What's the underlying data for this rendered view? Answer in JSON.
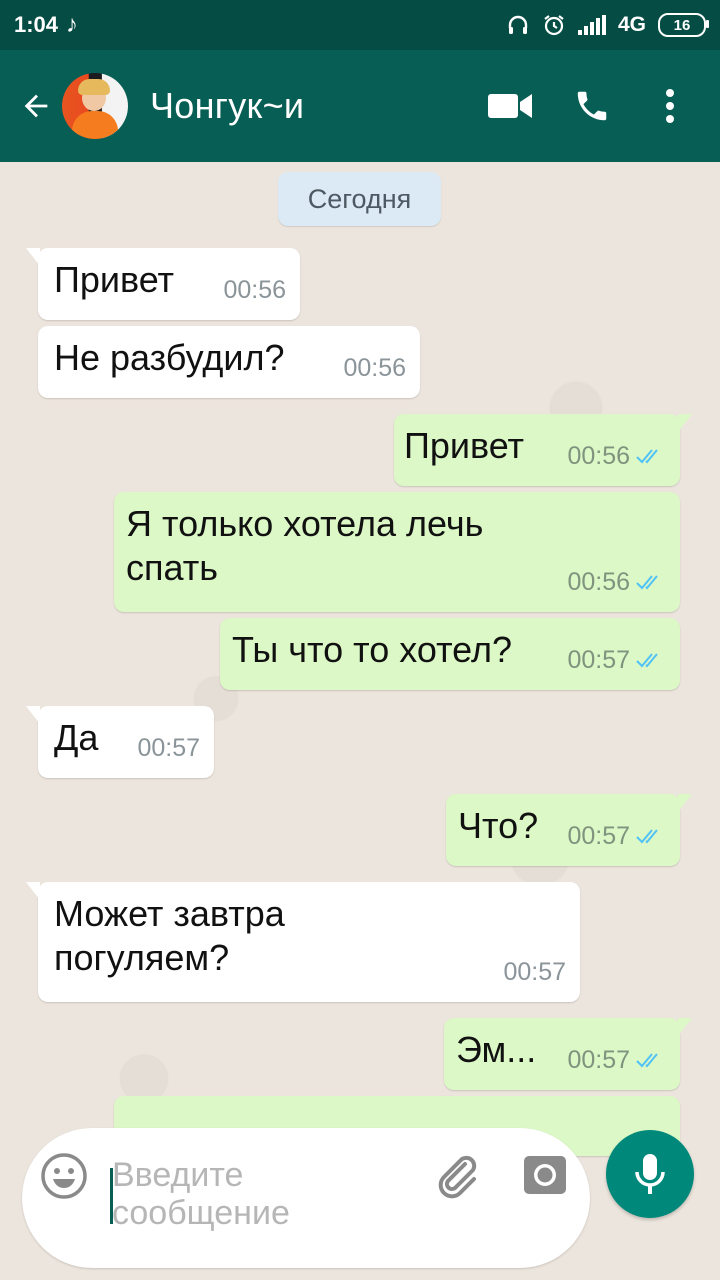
{
  "status_bar": {
    "time": "1:04",
    "network": "4G",
    "battery": "16"
  },
  "header": {
    "contact_name": "Чонгук~и"
  },
  "chat": {
    "date_label": "Сегодня",
    "messages": [
      {
        "text": "Привет",
        "time": "00:56"
      },
      {
        "text": "Не разбудил?",
        "time": "00:56"
      },
      {
        "text": "Привет",
        "time": "00:56"
      },
      {
        "text": "Я только хотела лечь\nспать",
        "time": "00:56"
      },
      {
        "text": "Ты что то хотел?",
        "time": "00:57"
      },
      {
        "text": "Да",
        "time": "00:57"
      },
      {
        "text": "Что?",
        "time": "00:57"
      },
      {
        "text": "Может завтра\nпогуляем?",
        "time": "00:57"
      },
      {
        "text": "Эм...",
        "time": "00:57"
      }
    ]
  },
  "composer": {
    "placeholder": "Введите\nсообщение"
  },
  "colors": {
    "toolbar": "#075e54",
    "status_bar": "#054d44",
    "incoming_bubble": "#ffffff",
    "outgoing_bubble": "#dcf8c6",
    "read_ticks": "#4fc3f7",
    "mic_button": "#00897b"
  }
}
